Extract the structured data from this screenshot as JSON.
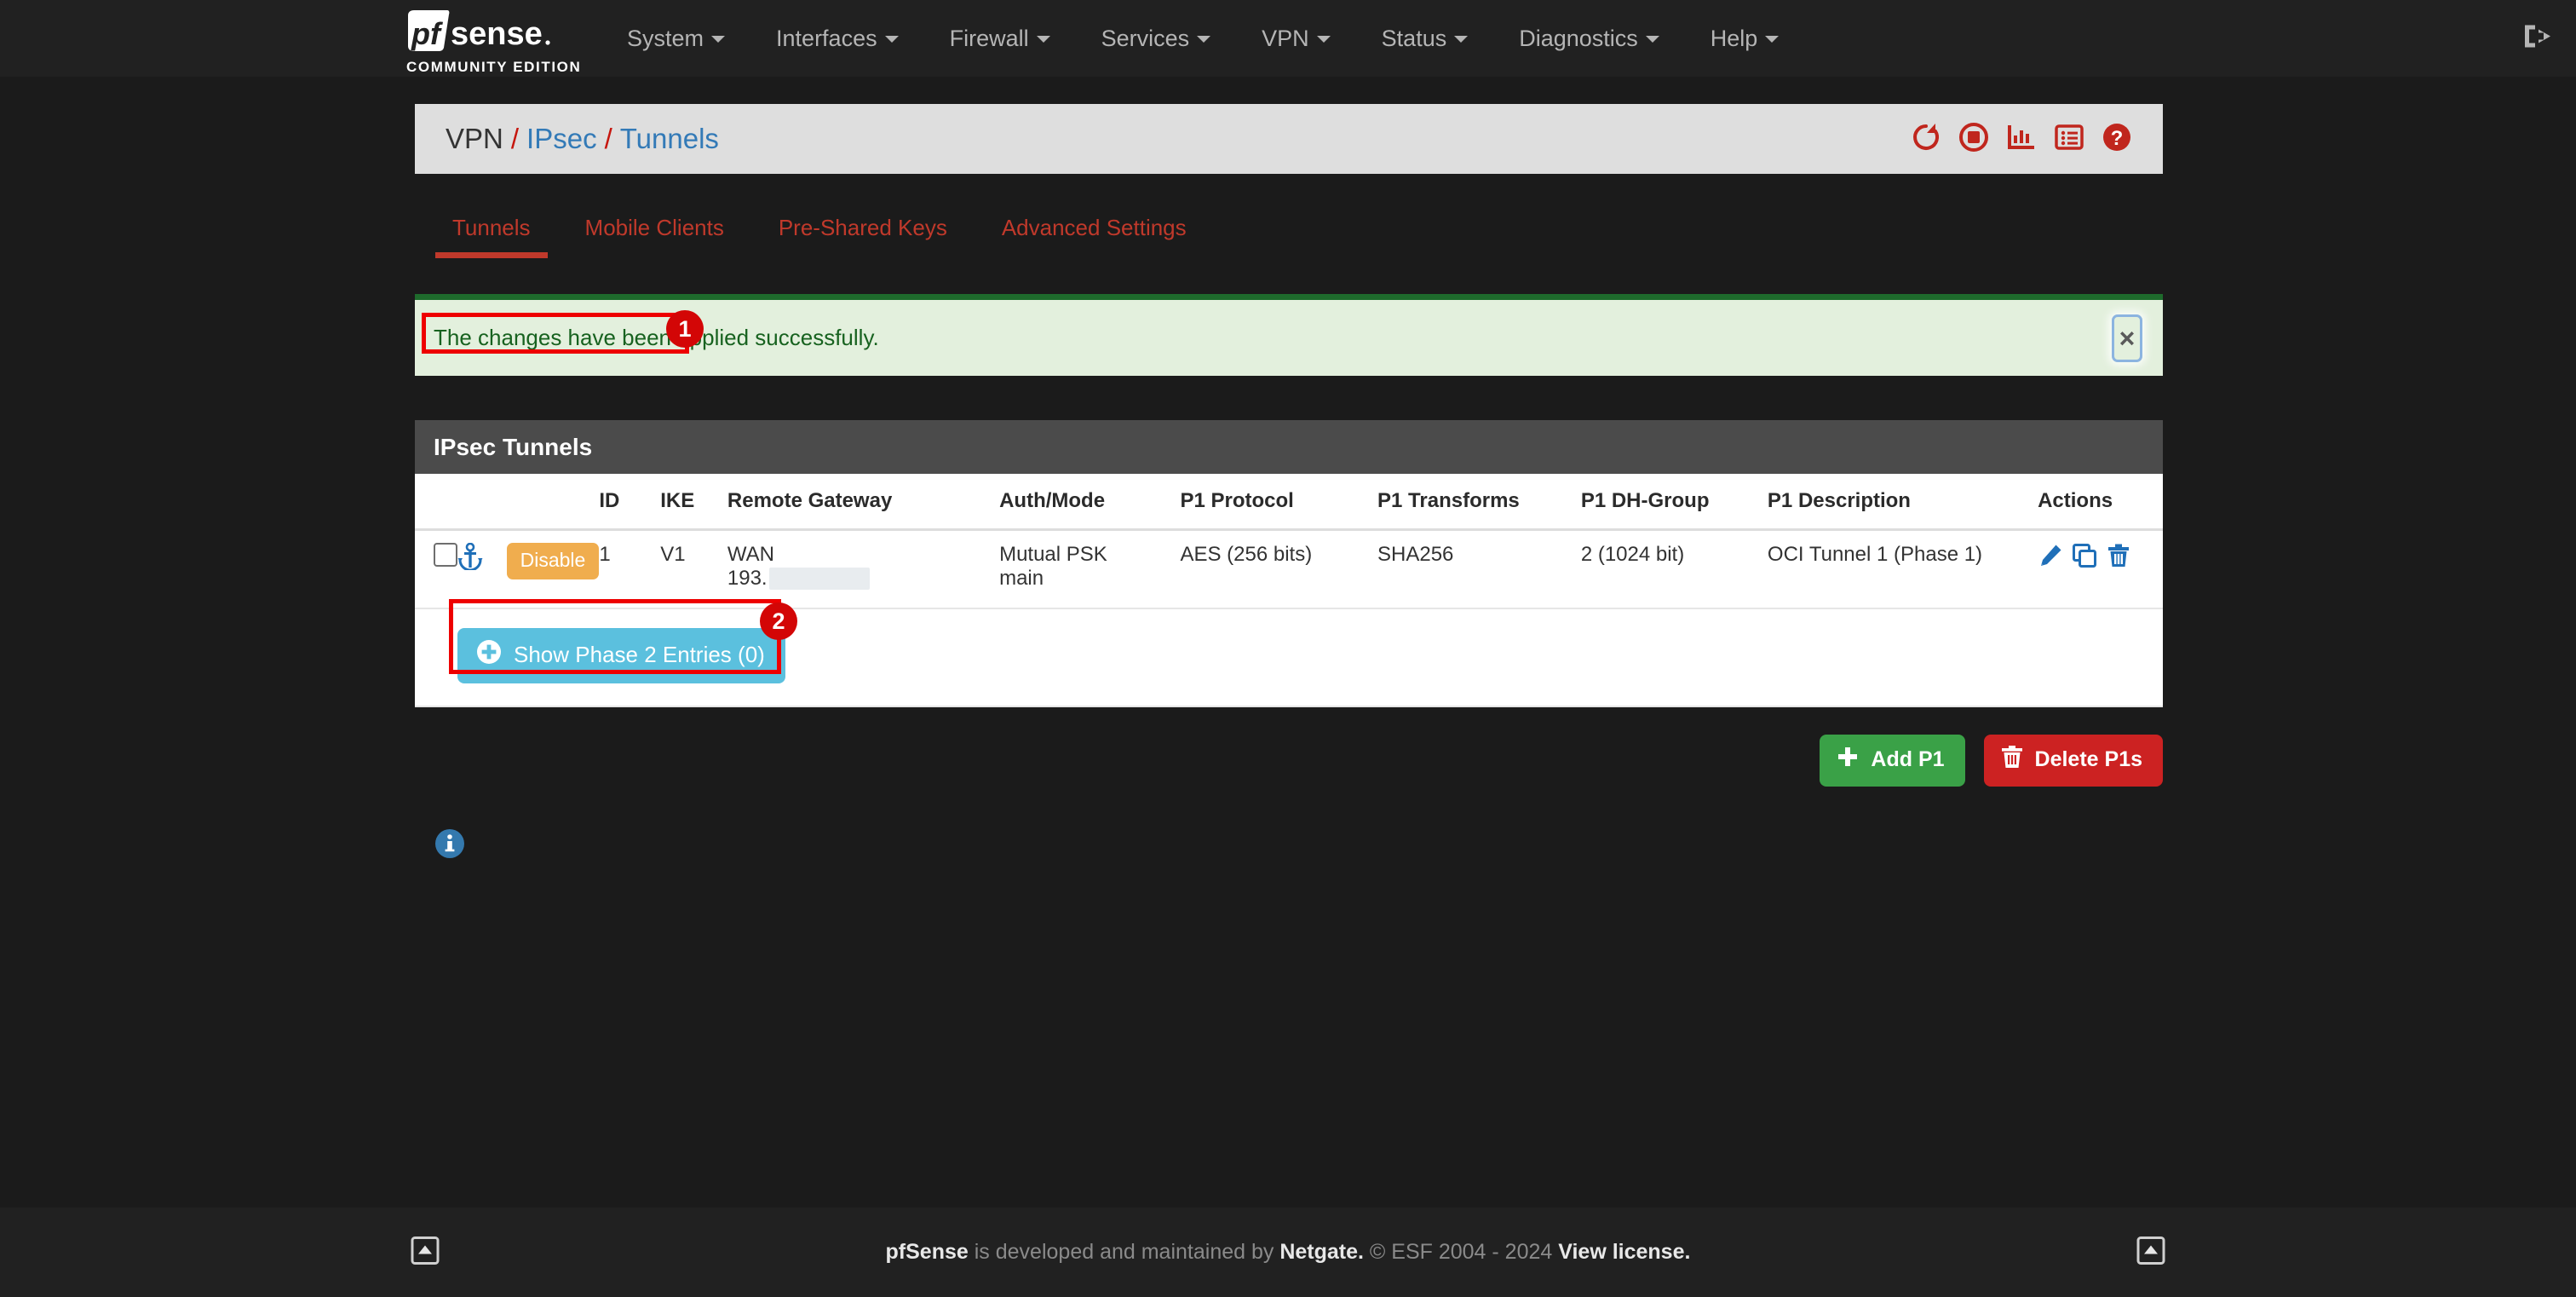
{
  "navbar": {
    "brand_name": "pfsense",
    "brand_subtitle": "COMMUNITY EDITION",
    "items": [
      {
        "label": "System",
        "has_caret": true
      },
      {
        "label": "Interfaces",
        "has_caret": true
      },
      {
        "label": "Firewall",
        "has_caret": true
      },
      {
        "label": "Services",
        "has_caret": true
      },
      {
        "label": "VPN",
        "has_caret": true
      },
      {
        "label": "Status",
        "has_caret": true
      },
      {
        "label": "Diagnostics",
        "has_caret": true
      },
      {
        "label": "Help",
        "has_caret": true
      }
    ],
    "logout_icon": "logout-icon"
  },
  "header": {
    "breadcrumb": {
      "root": "VPN",
      "sep": "/",
      "middle": "IPsec",
      "current": "Tunnels"
    },
    "icons": [
      {
        "name": "restart-service-icon",
        "title": "Restart IPsec"
      },
      {
        "name": "stop-service-icon",
        "title": "Stop IPsec"
      },
      {
        "name": "status-chart-icon",
        "title": "Status"
      },
      {
        "name": "log-list-icon",
        "title": "Logs"
      },
      {
        "name": "help-icon",
        "title": "Help"
      }
    ]
  },
  "tabs": [
    {
      "label": "Tunnels",
      "active": true
    },
    {
      "label": "Mobile Clients",
      "active": false
    },
    {
      "label": "Pre-Shared Keys",
      "active": false
    },
    {
      "label": "Advanced Settings",
      "active": false
    }
  ],
  "alert": {
    "message": "The changes have been applied successfully.",
    "close_label": "×",
    "border_color": "#1e6b2c",
    "background_color": "#e3f0dd",
    "text_color": "#17621f"
  },
  "panel": {
    "title": "IPsec Tunnels",
    "columns": [
      "",
      "",
      "",
      "ID",
      "IKE",
      "Remote Gateway",
      "Auth/Mode",
      "P1 Protocol",
      "P1 Transforms",
      "P1 DH-Group",
      "P1 Description",
      "Actions"
    ],
    "rows": [
      {
        "selected": false,
        "anchor_icon": "anchor-icon",
        "toggle_label": "Disable",
        "id": "1",
        "ike": "V1",
        "gateway_interface": "WAN",
        "gateway_address": "193.",
        "gateway_redacted": true,
        "auth": "Mutual PSK",
        "mode": "main",
        "p1_protocol": "AES (256 bits)",
        "p1_transforms": "SHA256",
        "p1_dh_group": "2 (1024 bit)",
        "p1_description": "OCI Tunnel 1 (Phase 1)",
        "actions": [
          {
            "name": "edit-p1-icon",
            "title": "Edit phase 1 entry"
          },
          {
            "name": "copy-p1-icon",
            "title": "Copy phase 1 entry"
          },
          {
            "name": "delete-p1-icon",
            "title": "Delete phase 1 entry"
          }
        ]
      }
    ],
    "show_phase2_label": "Show Phase 2 Entries (0)"
  },
  "buttons": {
    "add_p1": "Add P1",
    "delete_p1s": "Delete P1s"
  },
  "info_icon": "info-circle-icon",
  "annotations": [
    {
      "number": "1",
      "target": "success-alert-message"
    },
    {
      "number": "2",
      "target": "show-phase2-button"
    }
  ],
  "footer": {
    "brand": "pfSense",
    "text_middle": " is developed and maintained by ",
    "netgate": "Netgate.",
    "copyright": " © ESF 2004 - 2024 ",
    "license": "View license.",
    "left_icon": "caret-square-up-icon",
    "right_icon": "caret-square-up-icon"
  },
  "colors": {
    "navbar_bg": "#212121",
    "accent_red": "#c0392b",
    "link_blue": "#337ab7",
    "info_blue": "#5bc0de",
    "warning_orange": "#f0ad4e",
    "success_green": "#3aa147",
    "danger_red": "#cc2222",
    "annotation_red": "#ee0000"
  }
}
